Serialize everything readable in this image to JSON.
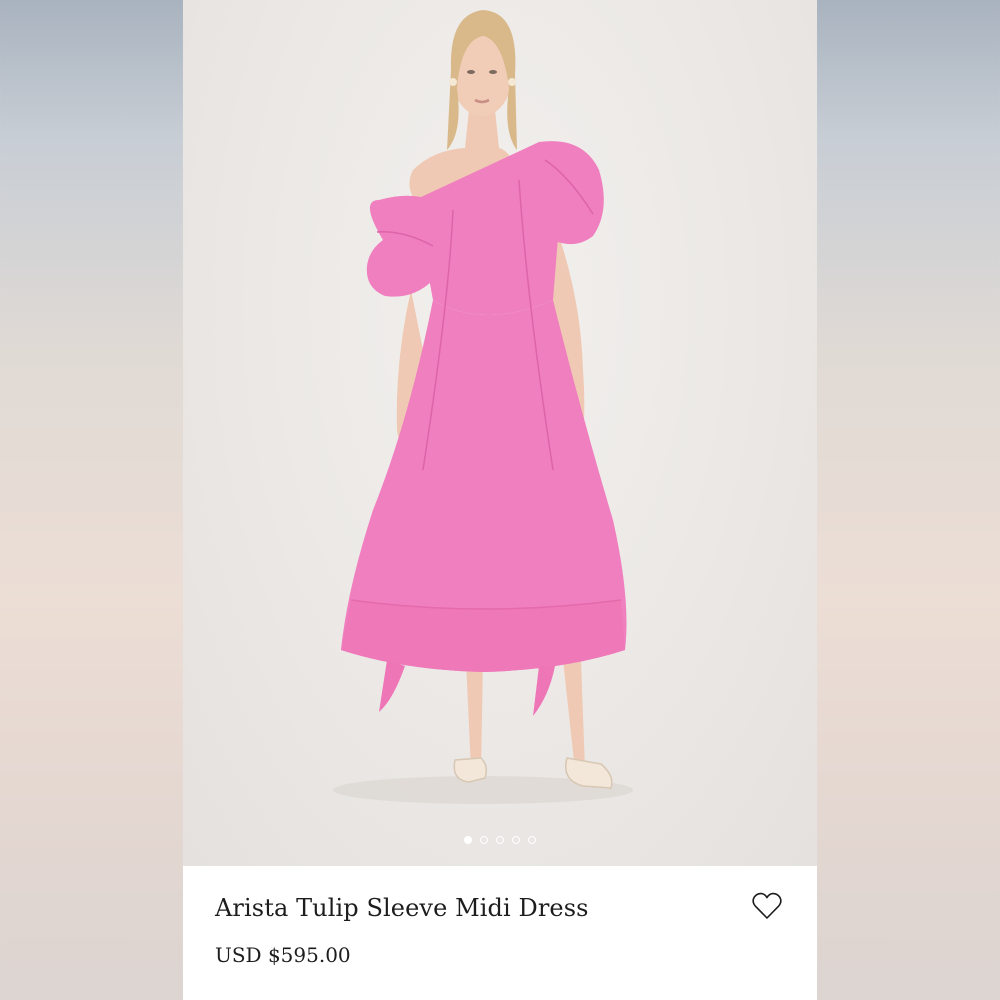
{
  "product": {
    "title": "Arista Tulip Sleeve Midi Dress",
    "price": "USD $595.00",
    "image_alt": "Model wearing pink one-shoulder midi dress with puff sleeves",
    "dress_color": "#f07fbf",
    "dress_shadow": "#dd64a8",
    "background_color": "#ece9e6"
  },
  "carousel": {
    "total": 5,
    "active_index": 0
  },
  "icons": {
    "wishlist": "heart-outline-icon"
  }
}
